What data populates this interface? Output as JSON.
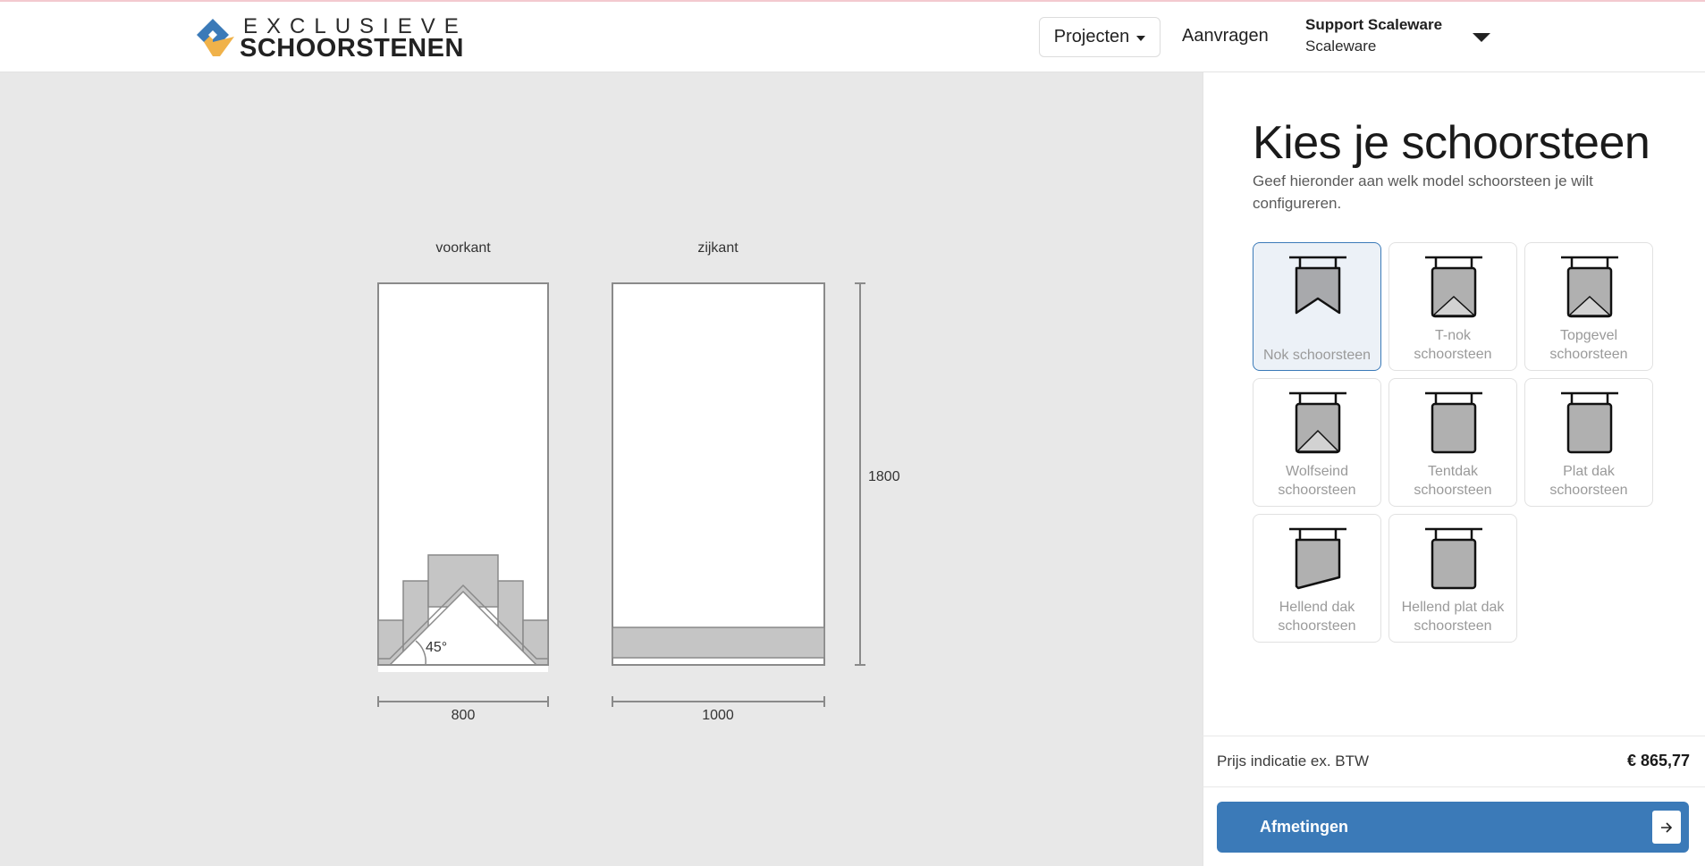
{
  "header": {
    "logo_line1": "EXCLUSIEVE",
    "logo_line2": "SCHOORSTENEN",
    "projects_label": "Projecten",
    "requests_label": "Aanvragen",
    "user_name": "Support Scaleware",
    "user_org": "Scaleware"
  },
  "drawing": {
    "front_label": "voorkant",
    "side_label": "zijkant",
    "height_label": "1800",
    "front_width_label": "800",
    "side_width_label": "1000",
    "angle_label": "45°"
  },
  "panel": {
    "title": "Kies je schoorsteen",
    "subtitle": "Geef hieronder aan welk model schoorsteen je wilt configureren.",
    "options": [
      {
        "line1": "",
        "line2": "Nok schoorsteen",
        "icon": "nok-chimney-icon",
        "selected": true
      },
      {
        "line1": "T-nok",
        "line2": "schoorsteen",
        "icon": "t-nok-chimney-icon",
        "selected": false
      },
      {
        "line1": "Topgevel",
        "line2": "schoorsteen",
        "icon": "topgevel-chimney-icon",
        "selected": false
      },
      {
        "line1": "Wolfseind",
        "line2": "schoorsteen",
        "icon": "wolfseind-chimney-icon",
        "selected": false
      },
      {
        "line1": "Tentdak",
        "line2": "schoorsteen",
        "icon": "tentdak-chimney-icon",
        "selected": false
      },
      {
        "line1": "Plat dak",
        "line2": "schoorsteen",
        "icon": "plat-dak-chimney-icon",
        "selected": false
      },
      {
        "line1": "Hellend dak",
        "line2": "schoorsteen",
        "icon": "hellend-dak-chimney-icon",
        "selected": false
      },
      {
        "line1": "Hellend plat dak",
        "line2": "schoorsteen",
        "icon": "hellend-plat-dak-chimney-icon",
        "selected": false
      }
    ],
    "price_label": "Prijs indicatie ex. BTW",
    "price_value": "€ 865,77",
    "cta_label": "Afmetingen"
  },
  "colors": {
    "accent": "#3b7ab8",
    "selected_bg": "#ecf1f7",
    "canvas_bg": "#e8e8e8",
    "logo_blue": "#3b7ab8",
    "logo_orange": "#f0b24a"
  }
}
